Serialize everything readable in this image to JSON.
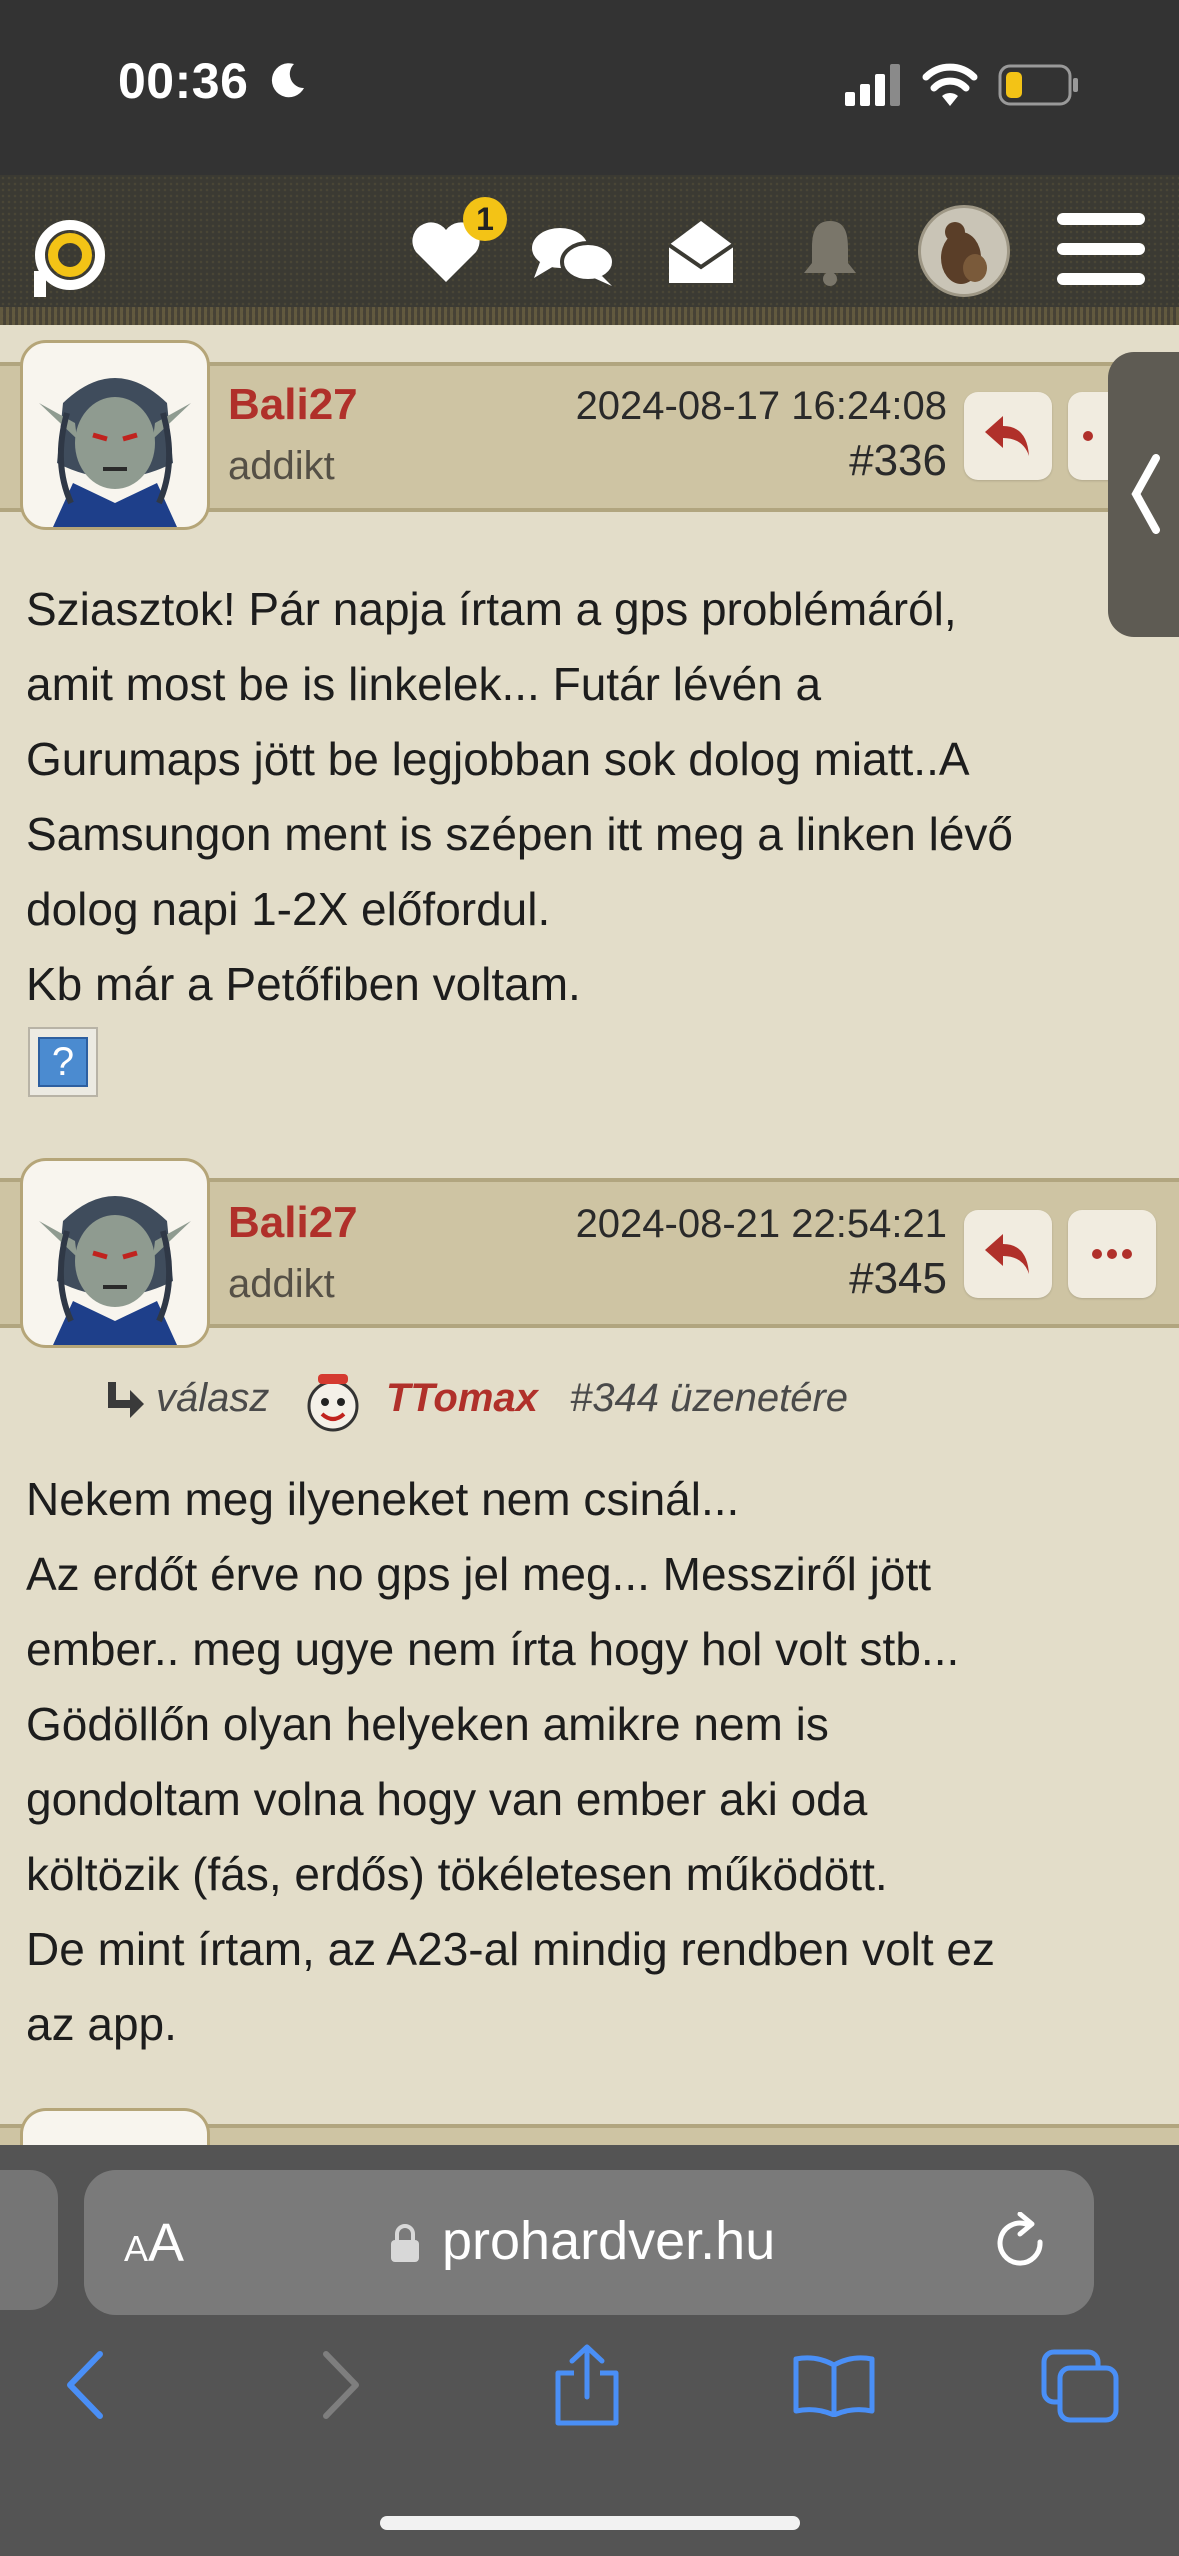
{
  "status_bar": {
    "time": "00:36",
    "battery_color": "#f3c316"
  },
  "nav": {
    "icons": [
      "logo-icon",
      "heart-icon",
      "chat-icon",
      "mail-icon",
      "bell-icon",
      "hamburger-icon"
    ],
    "notification_count": "1",
    "accent": "#f3c316"
  },
  "posts": [
    {
      "username": "Bali27",
      "rank": "addikt",
      "date": "2024-08-17 16:24:08",
      "number": "#336",
      "lines": [
        "Sziasztok! Pár napja írtam a gps problémáról,",
        "amit most be is linkelek... Futár lévén a",
        "Gurumaps jött be legjobban sok dolog miatt..A",
        "Samsungon ment is szépen itt meg a linken lévő",
        "dolog napi 1-2X előfordul.",
        "Kb már a Petőfiben voltam."
      ],
      "image_placeholder": "?"
    },
    {
      "username": "Bali27",
      "rank": "addikt",
      "date": "2024-08-21 22:54:21",
      "number": "#345",
      "reply": {
        "prefix": "válasz",
        "user": "TTomax",
        "suffix": "#344 üzenetére"
      },
      "lines": [
        "Nekem meg ilyeneket nem csinál...",
        "Az erdőt érve no gps jel meg... Messziről jött",
        "ember.. meg ugye nem írta hogy hol volt stb...",
        "Gödöllőn olyan helyeken amikre nem is",
        "gondoltam volna hogy van ember aki oda",
        "költözik (fás, erdős) tökéletesen működött.",
        "De mint írtam, az A23-al mindig rendben volt ez",
        "az app."
      ]
    }
  ],
  "colors": {
    "username": "#b0302a",
    "header_bg": "#cec4a3",
    "page_bg": "#e3ddc9"
  },
  "browser": {
    "text_size_label": "AA",
    "url": "prohardver.hu",
    "toolbar_icons": [
      "back-icon",
      "forward-icon",
      "share-icon",
      "bookmarks-icon",
      "tabs-icon"
    ]
  }
}
